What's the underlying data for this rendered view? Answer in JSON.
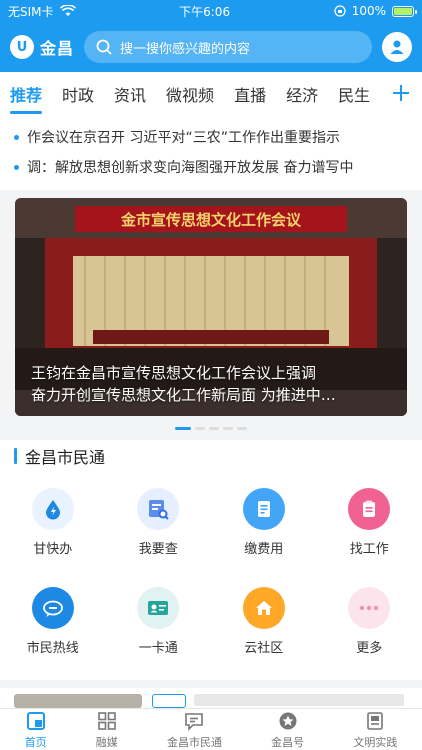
{
  "status": {
    "carrier": "无SIM卡",
    "time": "下午6:06",
    "battery": "100%"
  },
  "header": {
    "logo_text": "金昌",
    "logo_mark": "U",
    "search_placeholder": "搜一搜你感兴趣的内容"
  },
  "tabs": [
    {
      "label": "推荐"
    },
    {
      "label": "时政"
    },
    {
      "label": "资讯"
    },
    {
      "label": "微视频"
    },
    {
      "label": "直播"
    },
    {
      "label": "经济"
    },
    {
      "label": "民生"
    }
  ],
  "ticker": [
    {
      "text": "作会议在京召开 习近平对“三农”工作作出重要指示"
    },
    {
      "text": "调：解放思想创新求变向海图强开放发展 奋力谱写中"
    }
  ],
  "banner": {
    "sign": "金市宣传思想文化工作会议",
    "caption_line1": "王钧在金昌市宣传思想文化工作会议上强调",
    "caption_line2": "奋力开创宣传思想文化工作新局面 为推进中…"
  },
  "services": {
    "title": "金昌市民通",
    "items": [
      {
        "label": "甘快办",
        "icon": "water-drop-icon",
        "color": "#1e88e5"
      },
      {
        "label": "我要查",
        "icon": "search-doc-icon",
        "color": "#5b8def"
      },
      {
        "label": "缴费用",
        "icon": "bill-icon",
        "color": "#42a5f5"
      },
      {
        "label": "找工作",
        "icon": "clipboard-icon",
        "color": "#f06292"
      },
      {
        "label": "市民热线",
        "icon": "hotline-icon",
        "color": "#1e88e5"
      },
      {
        "label": "一卡通",
        "icon": "card-icon",
        "color": "#26a69a"
      },
      {
        "label": "云社区",
        "icon": "house-icon",
        "color": "#ffa726"
      },
      {
        "label": "更多",
        "icon": "more-icon",
        "color": "#f48fb1"
      }
    ]
  },
  "tabbar": [
    {
      "label": "首页"
    },
    {
      "label": "融媒"
    },
    {
      "label": "金昌市民通"
    },
    {
      "label": "金昌号"
    },
    {
      "label": "文明实践"
    }
  ],
  "colors": {
    "brand": "#1d9bf0"
  }
}
